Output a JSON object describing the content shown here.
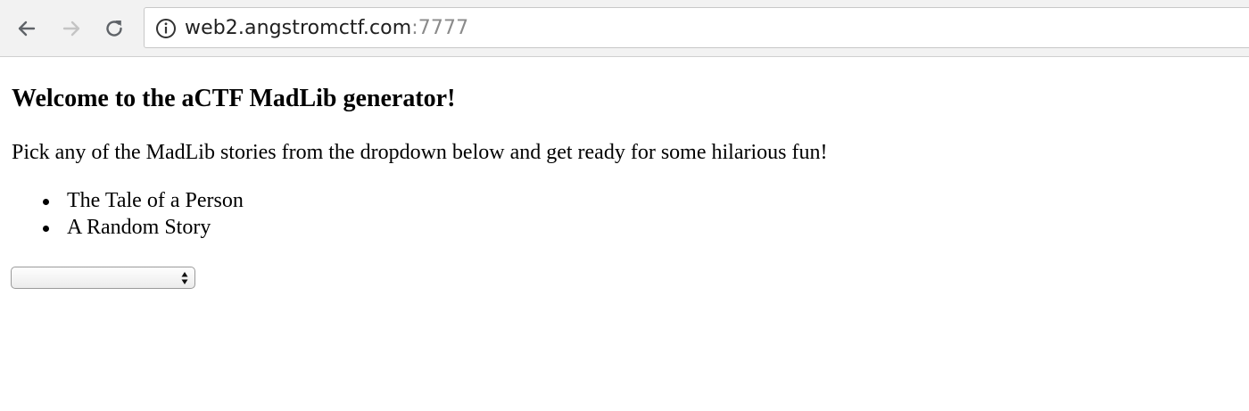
{
  "browser": {
    "url_host": "web2.angstromctf.com",
    "url_port": ":7777",
    "icons": {
      "back": "back-arrow-icon",
      "forward": "forward-arrow-icon",
      "reload": "reload-icon",
      "site_info": "info-icon"
    }
  },
  "page": {
    "heading": "Welcome to the aCTF MadLib generator!",
    "intro": "Pick any of the MadLib stories from the dropdown below and get ready for some hilarious fun!",
    "stories": [
      "The Tale of a Person",
      "A Random Story"
    ],
    "dropdown": {
      "selected": ""
    }
  },
  "colors": {
    "toolbar_bg": "#f2f2f2",
    "url_port": "#8a8a8a",
    "forward_disabled": "#c4c4c4"
  }
}
